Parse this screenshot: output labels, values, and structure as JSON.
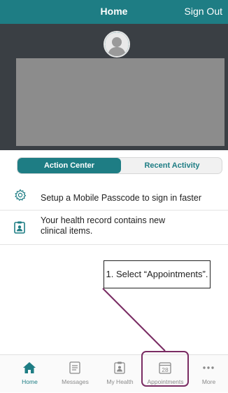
{
  "header": {
    "title": "Home",
    "sign_out": "Sign Out"
  },
  "segments": {
    "action_center": "Action Center",
    "recent_activity": "Recent Activity"
  },
  "action_items": [
    {
      "icon": "gear-icon",
      "text": "Setup a Mobile Passcode to sign in faster"
    },
    {
      "icon": "health-record-icon",
      "text": "Your health record contains new clinical items."
    }
  ],
  "callout": {
    "text": "1. Select “Appointments”."
  },
  "tabs": [
    {
      "label": "Home",
      "icon": "home-icon",
      "active": true
    },
    {
      "label": "Messages",
      "icon": "messages-icon",
      "active": false
    },
    {
      "label": "My Health",
      "icon": "my-health-icon",
      "active": false
    },
    {
      "label": "Appointments",
      "icon": "calendar-icon",
      "active": false,
      "badge": "28"
    },
    {
      "label": "More",
      "icon": "more-icon",
      "active": false
    }
  ],
  "colors": {
    "brand": "#1e7d84",
    "highlight": "#7a2c63"
  }
}
